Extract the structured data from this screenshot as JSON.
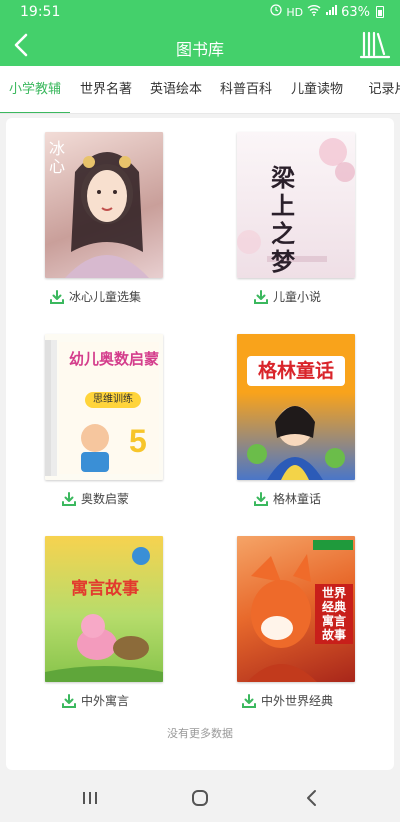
{
  "status_bar": {
    "time": "19:51",
    "battery": "63%",
    "network": "HD"
  },
  "header": {
    "title": "图书库"
  },
  "tabs": [
    {
      "label": "小学教辅",
      "active": true
    },
    {
      "label": "世界名著",
      "active": false
    },
    {
      "label": "英语绘本",
      "active": false
    },
    {
      "label": "科普百科",
      "active": false
    },
    {
      "label": "儿童读物",
      "active": false
    },
    {
      "label": "记录片",
      "active": false
    }
  ],
  "books": [
    {
      "title": "冰心儿童选集",
      "cover_text": "冰心",
      "cover_colors": [
        "#e8c9c4",
        "#b98a8a"
      ]
    },
    {
      "title": "儿童小说",
      "cover_text": "梁上之梦",
      "cover_colors": [
        "#f7f1f4",
        "#e7c9d4"
      ]
    },
    {
      "title": "奥数启蒙",
      "cover_text": "幼儿奥数启蒙",
      "cover_sub": "思维训练",
      "cover_colors": [
        "#fdfbf3",
        "#fce49a"
      ]
    },
    {
      "title": "格林童话",
      "cover_text": "格林童话",
      "cover_colors": [
        "#f9a31b",
        "#4a76c8"
      ]
    },
    {
      "title": "中外寓言",
      "cover_text": "寓言故事",
      "cover_colors": [
        "#9dd060",
        "#f6c54a"
      ]
    },
    {
      "title": "中外世界经典",
      "cover_text": "世界经典寓言故事",
      "cover_colors": [
        "#f07431",
        "#b2271c"
      ]
    }
  ],
  "footer_text": "没有更多数据",
  "colors": {
    "accent": "#44d06b",
    "tab_active": "#3bb85e"
  }
}
